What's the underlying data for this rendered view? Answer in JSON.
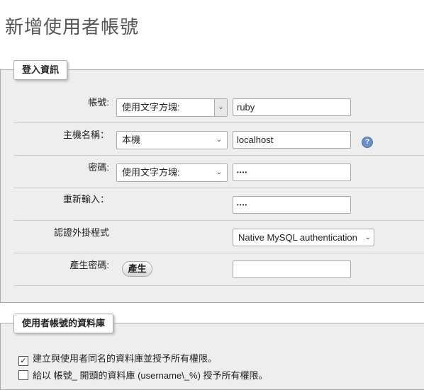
{
  "page": {
    "title": "新增使用者帳號"
  },
  "login": {
    "legend": "登入資訊",
    "username": {
      "label": "帳號:",
      "type_value": "使用文字方塊:",
      "value": "ruby"
    },
    "host": {
      "label": "主機名稱：",
      "type_value": "本機",
      "value": "localhost",
      "help_icon": "question-icon"
    },
    "password": {
      "label": "密碼:",
      "type_value": "使用文字方塊:",
      "value": "••••"
    },
    "retype": {
      "label": "重新輸入：",
      "value": "••••"
    },
    "auth_plugin": {
      "label": "認證外掛程式",
      "value": "Native MySQL authentication"
    },
    "generate": {
      "label": "產生密碼:",
      "button": "產生",
      "value": ""
    }
  },
  "database": {
    "legend": "使用者帳號的資料庫",
    "options": [
      {
        "label": "建立與使用者同名的資料庫並授予所有權限。",
        "checked": true
      },
      {
        "label": "給以 帳號_ 開頭的資料庫 (username\\_%) 授予所有權限。",
        "checked": false
      }
    ]
  }
}
